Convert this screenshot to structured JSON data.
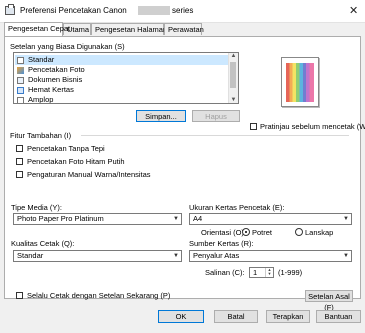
{
  "window": {
    "title": "Preferensi Pencetakan Canon",
    "title_suffix": "series",
    "close_glyph": "✕"
  },
  "tabs": [
    {
      "label": "Pengesetan Cepat",
      "active": true
    },
    {
      "label": "Utama",
      "active": false
    },
    {
      "label": "Pengesetan Halaman",
      "active": false
    },
    {
      "label": "Perawatan",
      "active": false
    }
  ],
  "common_settings": {
    "label": "Setelan yang Biasa Digunakan (S)",
    "items": [
      {
        "label": "Standar",
        "icon": "document-icon",
        "selected": true
      },
      {
        "label": "Pencetakan Foto",
        "icon": "photo-icon",
        "selected": false
      },
      {
        "label": "Dokumen Bisnis",
        "icon": "business-document-icon",
        "selected": false
      },
      {
        "label": "Hemat Kertas",
        "icon": "paper-saving-icon",
        "selected": false
      },
      {
        "label": "Amplop",
        "icon": "envelope-icon",
        "selected": false
      }
    ],
    "save_button": "Simpan...",
    "delete_button": "Hapus"
  },
  "preview": {
    "checkbox_label": "Pratinjau sebelum mencetak (W)",
    "checked": false
  },
  "additional_features": {
    "label": "Fitur Tambahan (I)",
    "options": [
      {
        "label": "Pencetakan Tanpa Tepi",
        "checked": false
      },
      {
        "label": "Pencetakan Foto Hitam Putih",
        "checked": false
      },
      {
        "label": "Pengaturan Manual Warna/Intensitas",
        "checked": false
      }
    ]
  },
  "media_type": {
    "label": "Tipe Media (Y):",
    "value": "Photo Paper Pro Platinum"
  },
  "print_quality": {
    "label": "Kualitas Cetak (Q):",
    "value": "Standar"
  },
  "paper_size": {
    "label": "Ukuran Kertas Pencetak (E):",
    "value": "A4"
  },
  "orientation": {
    "label": "Orientasi (O)",
    "options": [
      {
        "label": "Potret",
        "selected": true
      },
      {
        "label": "Lanskap",
        "selected": false
      }
    ]
  },
  "paper_source": {
    "label": "Sumber Kertas (R):",
    "value": "Penyalur Atas"
  },
  "copies": {
    "label": "Salinan (C):",
    "value": "1",
    "range": "(1-999)"
  },
  "always_print": {
    "label": "Selalu Cetak dengan Setelan Sekarang (P)",
    "checked": false
  },
  "defaults_button": "Setelan Asal (F)",
  "footer": {
    "ok": "OK",
    "cancel": "Batal",
    "apply": "Terapkan",
    "help": "Bantuan"
  },
  "colors": {
    "accent": "#0078d7",
    "selection": "#cce8ff"
  }
}
